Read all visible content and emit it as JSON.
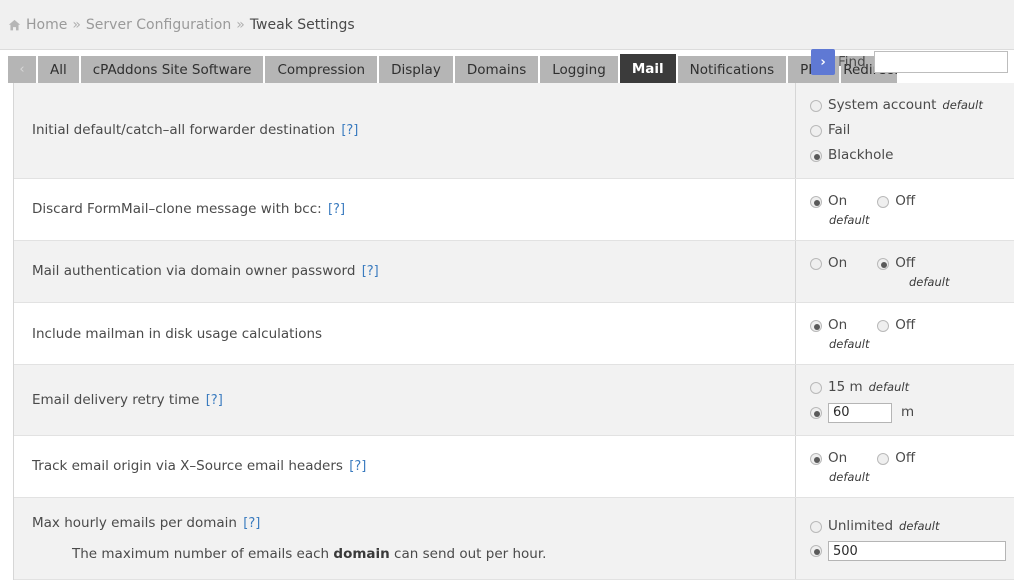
{
  "breadcrumb": {
    "home_icon": "home-icon",
    "items": [
      {
        "label": "Home",
        "current": false
      },
      {
        "label": "Server Configuration",
        "current": false
      },
      {
        "label": "Tweak Settings",
        "current": true
      }
    ],
    "separator": "»"
  },
  "tabbar": {
    "prev_arrow": "‹",
    "next_arrow": "›",
    "tabs": [
      {
        "label": "All",
        "active": false
      },
      {
        "label": "cPAddons Site Software",
        "active": false
      },
      {
        "label": "Compression",
        "active": false
      },
      {
        "label": "Display",
        "active": false
      },
      {
        "label": "Domains",
        "active": false
      },
      {
        "label": "Logging",
        "active": false
      },
      {
        "label": "Mail",
        "active": true
      },
      {
        "label": "Notifications",
        "active": false
      },
      {
        "label": "PHP",
        "active": false
      },
      {
        "label": "Redirects",
        "active": false
      }
    ],
    "find_label": "Find",
    "find_value": "",
    "find_placeholder": ""
  },
  "colors": {
    "accent_blue": "#5f79d4",
    "link_blue": "#3a7bbf",
    "active_tab": "#3b3b3b",
    "tab_grey": "#b5b5b5",
    "row_odd": "#f2f2f2",
    "row_even": "#ffffff"
  },
  "help_marker": "[?]",
  "settings": [
    {
      "label": "Initial default/catch–all forwarder destination",
      "help": true,
      "description": null,
      "control": "radio-list",
      "options": [
        {
          "label": "System account",
          "checked": false,
          "default": true
        },
        {
          "label": "Fail",
          "checked": false,
          "default": false
        },
        {
          "label": "Blackhole",
          "checked": true,
          "default": false
        }
      ]
    },
    {
      "label": "Discard FormMail–clone message with bcc:",
      "help": true,
      "description": null,
      "control": "on-off",
      "options": [
        {
          "label": "On",
          "checked": true,
          "default": true
        },
        {
          "label": "Off",
          "checked": false,
          "default": false
        }
      ]
    },
    {
      "label": "Mail authentication via domain owner password",
      "help": true,
      "description": null,
      "control": "on-off",
      "options": [
        {
          "label": "On",
          "checked": false,
          "default": false
        },
        {
          "label": "Off",
          "checked": true,
          "default": true
        }
      ]
    },
    {
      "label": "Include mailman in disk usage calculations",
      "help": false,
      "description": null,
      "control": "on-off",
      "options": [
        {
          "label": "On",
          "checked": true,
          "default": true
        },
        {
          "label": "Off",
          "checked": false,
          "default": false
        }
      ]
    },
    {
      "label": "Email delivery retry time",
      "help": true,
      "description": null,
      "control": "radio-input",
      "options": [
        {
          "label": "15 m",
          "checked": false,
          "default": true
        },
        {
          "label": "",
          "checked": true,
          "default": false,
          "value": "60",
          "unit": "m",
          "input_size": "small"
        }
      ]
    },
    {
      "label": "Track email origin via X–Source email headers",
      "help": true,
      "description": null,
      "control": "on-off",
      "options": [
        {
          "label": "On",
          "checked": true,
          "default": true
        },
        {
          "label": "Off",
          "checked": false,
          "default": false
        }
      ]
    },
    {
      "label": "Max hourly emails per domain",
      "help": true,
      "description_pre": "The maximum number of emails each ",
      "description_bold": "domain",
      "description_post": " can send out per hour.",
      "control": "radio-input",
      "options": [
        {
          "label": "Unlimited",
          "checked": false,
          "default": true
        },
        {
          "label": "",
          "checked": true,
          "default": false,
          "value": "500",
          "unit": "",
          "input_size": "wide"
        }
      ]
    }
  ]
}
